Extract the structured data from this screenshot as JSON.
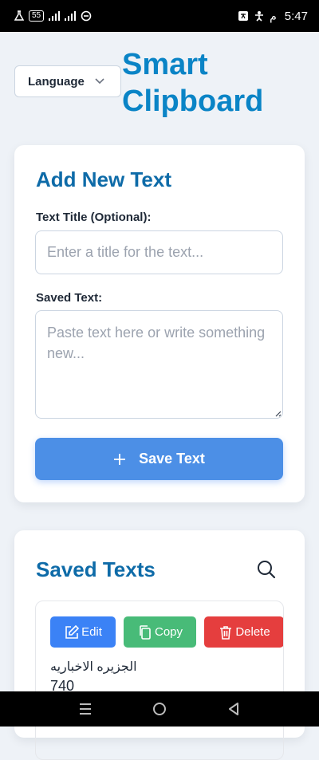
{
  "status_bar": {
    "battery_level": "55",
    "time": "5:47",
    "ampm": "م",
    "icons": [
      "lab-icon",
      "battery-icon",
      "signal-icon",
      "signal-icon",
      "data-saver-icon",
      "translate-icon",
      "accessibility-icon"
    ]
  },
  "header": {
    "language_label": "Language",
    "app_title": "Smart Clipboard"
  },
  "add_card": {
    "title": "Add New Text",
    "title_field_label": "Text Title (Optional):",
    "title_placeholder": "Enter a title for the text...",
    "title_value": "",
    "text_field_label": "Saved Text:",
    "text_placeholder": "Paste text here or write something new...",
    "text_value": "",
    "save_label": "Save Text"
  },
  "saved_card": {
    "title": "Saved Texts",
    "items": [
      {
        "edit_label": "Edit",
        "copy_label": "Copy",
        "delete_label": "Delete",
        "title": "الجزيره الاخباريه",
        "content": "740"
      }
    ]
  },
  "colors": {
    "brand": "#0a84c6",
    "heading": "#0e6ba8",
    "save_button": "#4c8fe6",
    "edit_button": "#3b82f6",
    "copy_button": "#48bb78",
    "delete_button": "#e53e3e",
    "page_background": "#eef2f7"
  }
}
